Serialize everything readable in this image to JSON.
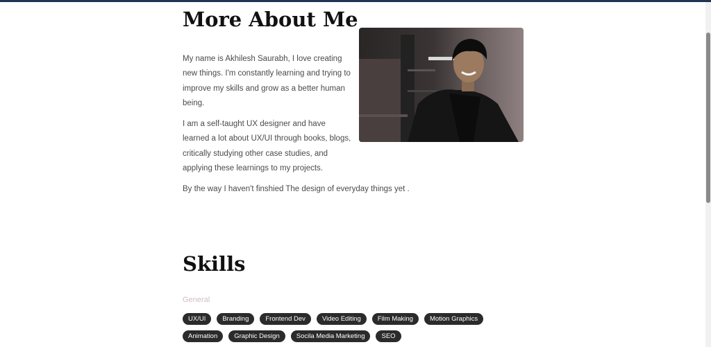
{
  "about": {
    "title": "More About Me",
    "paragraphs": [
      "My name is Akhilesh Saurabh, I love creating new things. I'm constantly learning and trying to improve my skills and grow as a better human being.",
      "I am a self-taught UX designer and have learned a lot about UX/UI through books, blogs, critically studying other case studies, and applying these learnings to my projects.",
      "By the way I haven't finshied The design of everyday things yet ."
    ],
    "photo_icon": "portrait-photo"
  },
  "skills": {
    "title": "Skills",
    "category": "General",
    "category_color": "#d2bcc4",
    "tag_color": "#2b2b2b",
    "tags_row1": [
      "UX/UI",
      "Branding",
      "Frontend Dev",
      "Video Editing",
      "Film Making",
      "Motion Graphics"
    ],
    "tags_row2": [
      "Animation",
      "Graphic Design",
      "Socila Media Marketing",
      "SEO"
    ]
  },
  "theme": {
    "topbar_color": "#1f3554"
  }
}
